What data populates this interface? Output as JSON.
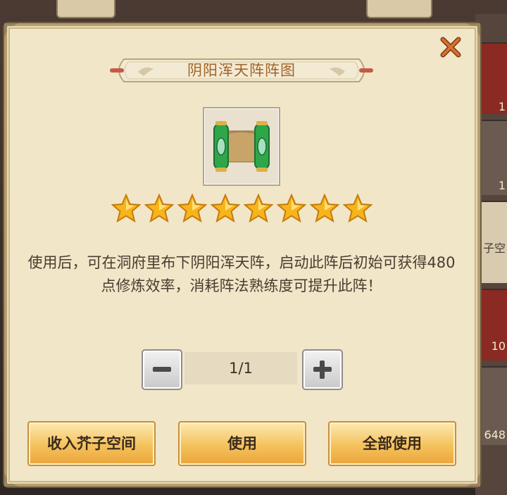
{
  "dialog": {
    "title": "阴阳浑天阵阵图",
    "item_icon": "scroll-icon",
    "star_rating": 8,
    "description": "使用后，可在洞府里布下阴阳浑天阵，启动此阵后初始可获得480点修炼效率，消耗阵法熟练度可提升此阵！",
    "quantity": "1/1",
    "buttons": {
      "store": "收入芥子空间",
      "use": "使用",
      "use_all": "全部使用"
    }
  },
  "background": {
    "right_numbers": [
      "1",
      "1",
      "10",
      "648"
    ],
    "right_label": "子空"
  },
  "colors": {
    "panel": "#f1e6c8",
    "title_text": "#a0642a",
    "button_gold": "#f4c25c",
    "close_x": "#c0602a"
  }
}
